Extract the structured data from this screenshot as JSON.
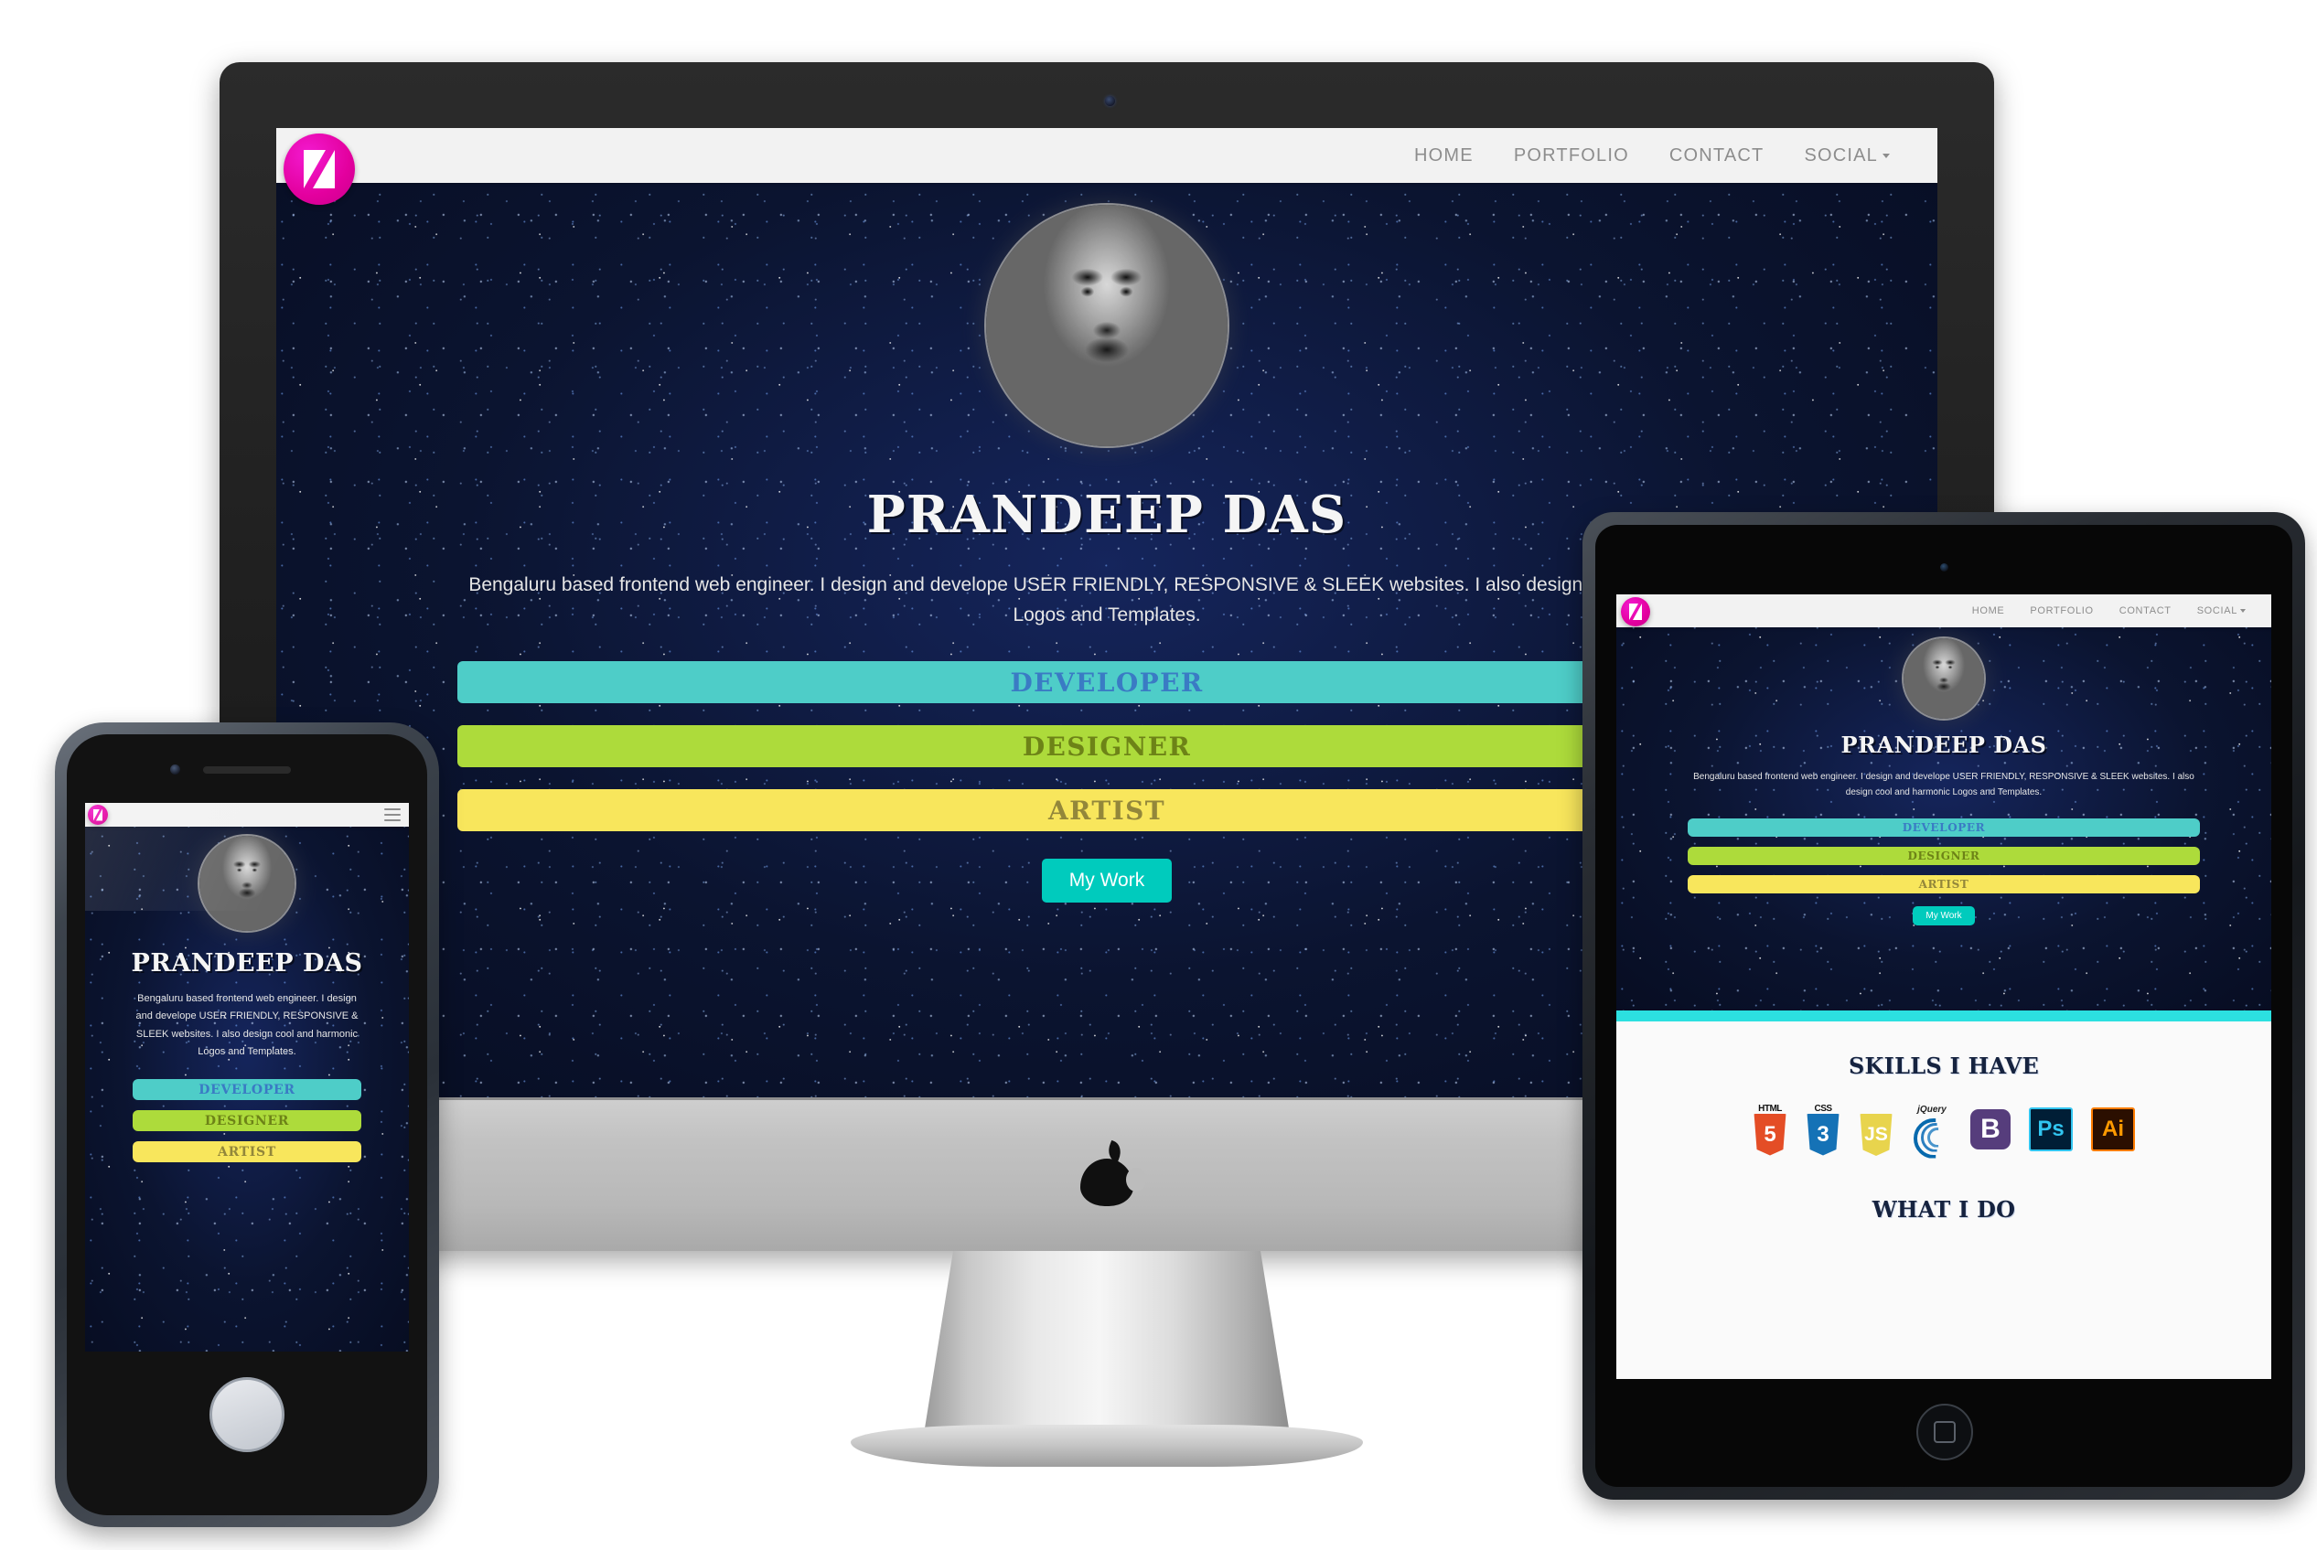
{
  "site": {
    "brand": {
      "icon": "z-slash-logo-icon",
      "color": "#e3009e"
    },
    "nav": [
      {
        "label": "HOME",
        "name": "home"
      },
      {
        "label": "PORTFOLIO",
        "name": "portfolio"
      },
      {
        "label": "CONTACT",
        "name": "contact"
      },
      {
        "label": "SOCIAL",
        "name": "social",
        "has_dropdown": true
      }
    ],
    "hero": {
      "name": "PRANDEEP DAS",
      "description": "Bengaluru based frontend web engineer. I design and develope USER FRIENDLY, RESPONSIVE & SLEEK websites. I also design cool and harmonic Logos and Templates.",
      "description_desktop_line1": "Bengaluru based frontend web engineer. I design and develope USER FRIENDLY, RESPONSIVE & SLEEK websites. I also design cool and harmonic",
      "description_desktop_line2": "Logos and Templates.",
      "bars": [
        {
          "label": "DEVELOPER",
          "bg": "#4ecdc8",
          "fg": "#3a7bc4"
        },
        {
          "label": "DESIGNER",
          "bg": "#addb3b",
          "fg": "#6d8317"
        },
        {
          "label": "ARTIST",
          "bg": "#f8e65c",
          "fg": "#93873a"
        }
      ],
      "cta": "My Work",
      "cta_color": "#00cbbd",
      "avatar_alt": "portrait-photo"
    },
    "skills": {
      "title": "SKILLS I HAVE",
      "divider_color": "#2ce0e0",
      "items": [
        {
          "name": "html5-icon",
          "label": "HTML",
          "mark": "5",
          "color": "#e44d26",
          "shade": "#f16529"
        },
        {
          "name": "css3-icon",
          "label": "CSS",
          "mark": "3",
          "color": "#1572b6",
          "shade": "#33a9dc"
        },
        {
          "name": "javascript-icon",
          "label": "",
          "mark": "JS",
          "color": "#e8d44d",
          "shade": "#f0db4f"
        },
        {
          "name": "jquery-icon",
          "label": "jQuery",
          "mark": "",
          "color": "#0769ad",
          "shade": "#ffffff"
        },
        {
          "name": "bootstrap-icon",
          "label": "",
          "mark": "B",
          "color": "#563d7c",
          "shade": "#ffffff"
        },
        {
          "name": "photoshop-icon",
          "label": "",
          "mark": "Ps",
          "color": "#001e36",
          "shade": "#31c5f0"
        },
        {
          "name": "illustrator-icon",
          "label": "",
          "mark": "Ai",
          "color": "#330000",
          "shade": "#ff9a00"
        }
      ]
    },
    "whatido": {
      "title": "WHAT I DO"
    }
  },
  "devices": {
    "desktop": {
      "name": "imac-desktop",
      "brand_mark": "apple-logo-icon"
    },
    "tablet": {
      "name": "ipad-tablet"
    },
    "phone": {
      "name": "iphone-mobile",
      "menu_icon": "hamburger-menu-icon"
    }
  }
}
